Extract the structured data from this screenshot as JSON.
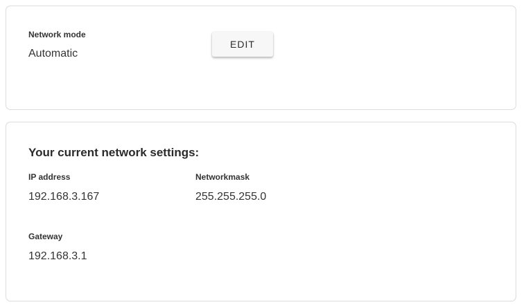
{
  "network_mode": {
    "label": "Network mode",
    "value": "Automatic",
    "edit_label": "EDIT"
  },
  "current_settings": {
    "heading": "Your current network settings:",
    "ip_address": {
      "label": "IP address",
      "value": "192.168.3.167"
    },
    "network_mask": {
      "label": "Networkmask",
      "value": "255.255.255.0"
    },
    "gateway": {
      "label": "Gateway",
      "value": "192.168.3.1"
    }
  }
}
